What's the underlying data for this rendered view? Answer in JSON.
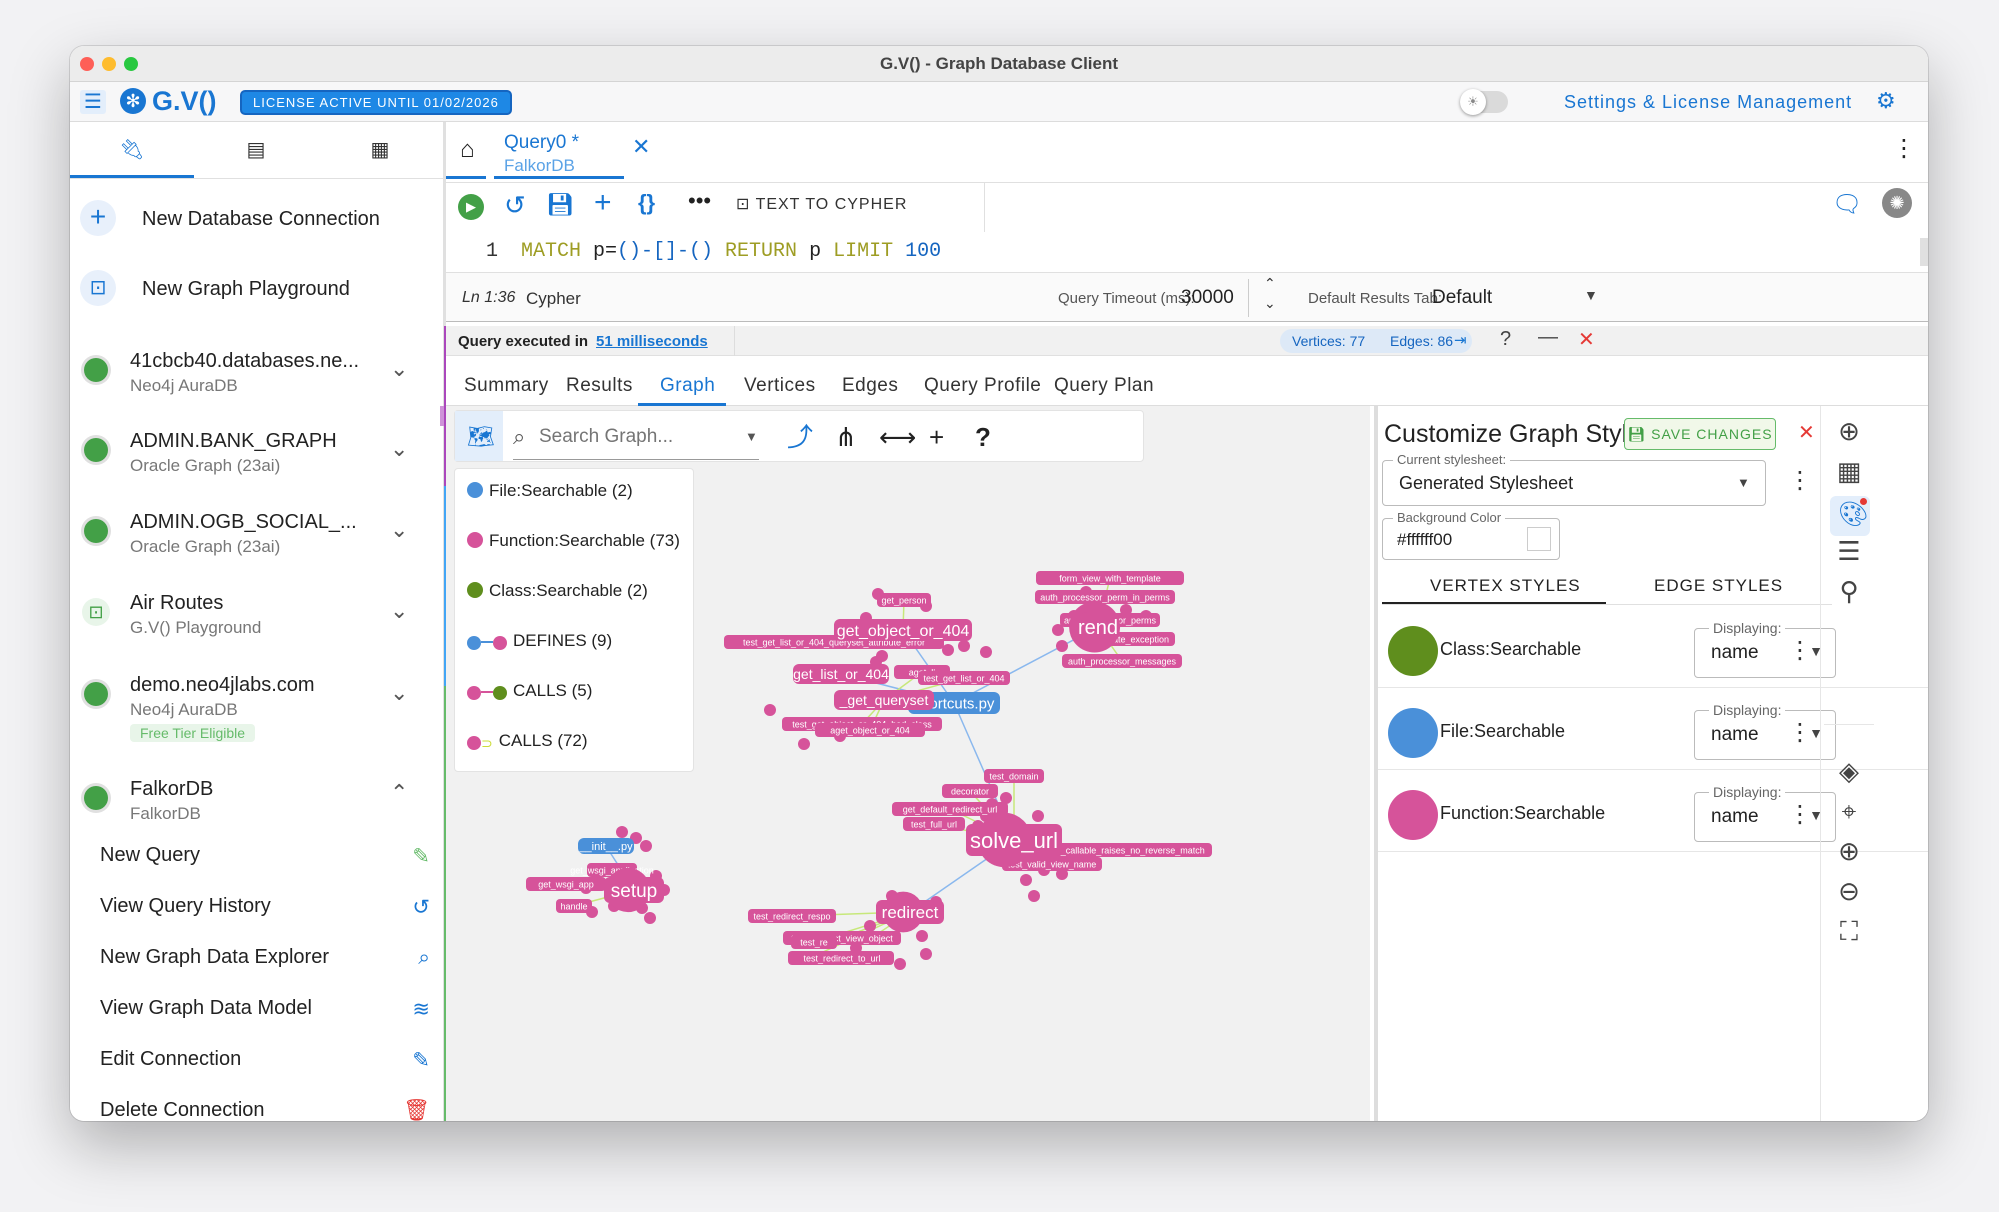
{
  "window": {
    "title": "G.V() - Graph Database Client"
  },
  "appbar": {
    "logo": "G.V()",
    "license": "LICENSE ACTIVE UNTIL 01/02/2026",
    "settings": "Settings & License Management"
  },
  "sidebar": {
    "actions": [
      {
        "label": "New Database Connection"
      },
      {
        "label": "New Graph Playground"
      }
    ],
    "connections": [
      {
        "name": "41cbcb40.databases.ne...",
        "type": "Neo4j AuraDB",
        "icon": "green-dot"
      },
      {
        "name": "ADMIN.BANK_GRAPH",
        "type": "Oracle Graph (23ai)",
        "icon": "green-dot"
      },
      {
        "name": "ADMIN.OGB_SOCIAL_...",
        "type": "Oracle Graph (23ai)",
        "icon": "green-dot"
      },
      {
        "name": "Air Routes",
        "type": "G.V() Playground",
        "icon": "playground"
      },
      {
        "name": "demo.neo4jlabs.com",
        "type": "Neo4j AuraDB",
        "badge": "Free Tier Eligible",
        "icon": "green-dot"
      },
      {
        "name": "FalkorDB",
        "type": "FalkorDB",
        "icon": "green-dot",
        "expanded": true
      }
    ],
    "falkor_actions": [
      {
        "label": "New Query",
        "icon": "magic-wand-icon"
      },
      {
        "label": "View Query History",
        "icon": "history-icon"
      },
      {
        "label": "New Graph Data Explorer",
        "icon": "explore-icon"
      },
      {
        "label": "View Graph Data Model",
        "icon": "database-icon"
      },
      {
        "label": "Edit Connection",
        "icon": "edit-icon"
      },
      {
        "label": "Delete Connection",
        "icon": "trash-icon"
      }
    ]
  },
  "query_tab": {
    "title": "Query0 *",
    "db": "FalkorDB"
  },
  "toolbar": {
    "text_to_cypher": "TEXT TO CYPHER"
  },
  "editor": {
    "line_number": "1",
    "tokens": [
      {
        "t": "MATCH",
        "c": "#9e9d24"
      },
      {
        "t": " p=",
        "c": "#222"
      },
      {
        "t": "()-[]-()",
        "c": "#1565c0"
      },
      {
        "t": " RETURN",
        "c": "#9e9d24"
      },
      {
        "t": " p ",
        "c": "#222"
      },
      {
        "t": "LIMIT",
        "c": "#9e9d24"
      },
      {
        "t": " 100",
        "c": "#1565c0"
      }
    ]
  },
  "status": {
    "position": "Ln 1:36",
    "language": "Cypher",
    "timeout_label": "Query Timeout (ms):",
    "timeout_value": "30000",
    "results_label": "Default Results Tab:",
    "results_value": "Default"
  },
  "results": {
    "executed_prefix": "Query executed in",
    "executed_time": "51 milliseconds",
    "vertices": "Vertices: 77",
    "edges": "Edges: 86",
    "tabs": [
      "Summary",
      "Results",
      "Graph",
      "Vertices",
      "Edges",
      "Query Profile",
      "Query Plan"
    ],
    "active_tab": "Graph"
  },
  "graph": {
    "search_placeholder": "Search Graph...",
    "legend": [
      {
        "label": "File:Searchable (2)",
        "color": "#4a90d9",
        "kind": "node"
      },
      {
        "label": "Function:Searchable (73)",
        "color": "#d6539a",
        "kind": "node"
      },
      {
        "label": "Class:Searchable (2)",
        "color": "#5f8e1d",
        "kind": "node"
      },
      {
        "label": "DEFINES (9)",
        "from": "#4a90d9",
        "to": "#d6539a",
        "kind": "edge"
      },
      {
        "label": "CALLS (5)",
        "from": "#d6539a",
        "to": "#5f8e1d",
        "kind": "edge"
      },
      {
        "label": "CALLS (72)",
        "from": "#d6539a",
        "to": "#cddc39",
        "kind": "loop"
      }
    ],
    "hubs": [
      {
        "label": "shortcuts.py",
        "color": "#4a90d9"
      },
      {
        "label": "solve_url",
        "color": "#d6539a"
      },
      {
        "label": "setup",
        "color": "#d6539a"
      },
      {
        "label": "redirect",
        "color": "#d6539a"
      },
      {
        "label": "get_object_or_404",
        "color": "#d6539a"
      },
      {
        "label": "get_list_or_404",
        "color": "#d6539a"
      },
      {
        "label": "_get_queryset",
        "color": "#d6539a"
      },
      {
        "label": "rend",
        "color": "#d6539a"
      },
      {
        "label": "__init__.py",
        "color": "#4a90d9"
      }
    ],
    "small_labels": [
      "get_person",
      "test_get_list_or_404_queryset_attribute_error",
      "aget_li",
      "test_get_list_or_404",
      "test_get_object_or_404_bad_class",
      "aget_object_or_404",
      "form_view_with_template",
      "auth_processor_perm_in_perms",
      "auth_processor_perms",
      "template_exception",
      "auth_processor_messages",
      "test_domain",
      "decorator",
      "get_default_redirect_url",
      "test_full_url",
      "test_non_view_callable_raises_no_reverse_match",
      "test_valid_view_name",
      "get_wsgi_application",
      "get_wsgi_app",
      "handle",
      "test_redirect_respo",
      "test_redirect_view_object",
      "test_re",
      "test_no_",
      "test_redirect_to_url"
    ]
  },
  "styles_panel": {
    "title": "Customize Graph Styles",
    "save": "SAVE CHANGES",
    "stylesheet_label": "Current stylesheet:",
    "stylesheet_value": "Generated Stylesheet",
    "bg_label": "Background Color",
    "bg_value": "#ffffff00",
    "tabs": [
      "VERTEX STYLES",
      "EDGE STYLES"
    ],
    "vertex_styles": [
      {
        "name": "Class:Searchable",
        "color": "#5f8e1d",
        "display_label": "Displaying:",
        "display": "name"
      },
      {
        "name": "File:Searchable",
        "color": "#4a90d9",
        "display_label": "Displaying:",
        "display": "name"
      },
      {
        "name": "Function:Searchable",
        "color": "#d6539a",
        "display_label": "Displaying:",
        "display": "name"
      }
    ]
  },
  "colors": {
    "accent": "#1976d2",
    "success": "#43a047",
    "danger": "#e53935",
    "function": "#d6539a",
    "file": "#4a90d9",
    "class": "#5f8e1d"
  }
}
